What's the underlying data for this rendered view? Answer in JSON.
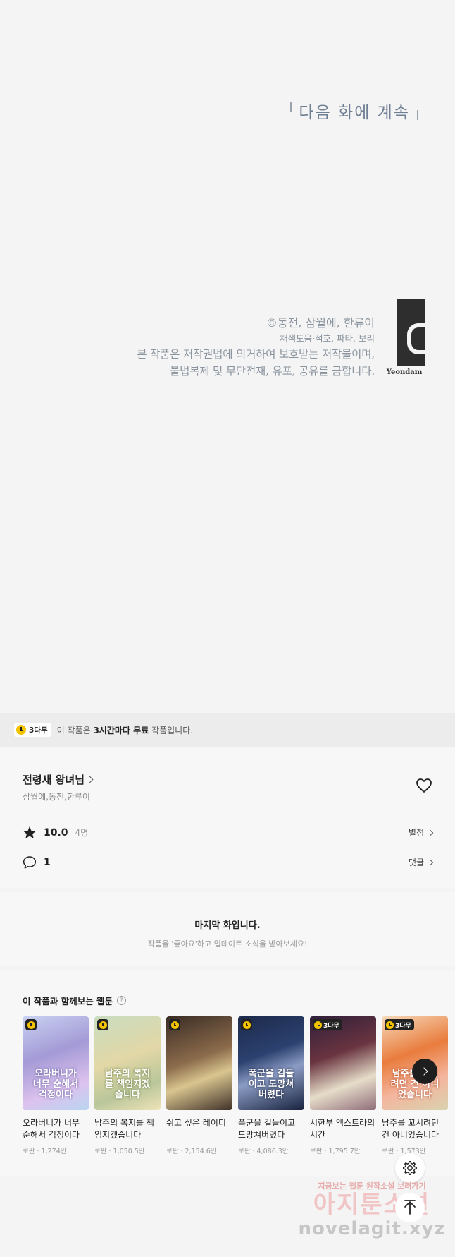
{
  "comic": {
    "next_episode": "다음 화에 계속",
    "credits": {
      "line1": "©동전, 삼월에, 한류이",
      "line2": "채색도움·석호, 파타, 보리",
      "line3": "본 작품은 저작권법에 의거하여 보호받는 저작물이며,",
      "line4": "불법복제 및 무단전재, 유포, 공유를 금합니다."
    },
    "publisher": "Yeondam"
  },
  "free_banner": {
    "badge": "3다무",
    "text_prefix": "이 작품은",
    "text_bold": "3시간마다 무료",
    "text_suffix": "작품입니다."
  },
  "work": {
    "title": "전령새 왕녀님",
    "authors": "삼월에,동전,한류이",
    "rating": "10.0",
    "rating_count": "4명",
    "rating_link": "별점",
    "comments": "1",
    "comments_link": "댓글"
  },
  "last_episode": {
    "heading": "마지막 화입니다.",
    "sub": "작품을 '좋아요'하고 업데이트 소식을 받아보세요!"
  },
  "recommendations": {
    "heading": "이 작품과 함께보는 웹툰",
    "items": [
      {
        "title": "오라버니가 너무 순해서 걱정이다",
        "meta": "로판 · 1,274만",
        "badge": "",
        "art": "오라버니가 너무 순해서 걱정이다"
      },
      {
        "title": "남주의 복지를 책임지겠습니다",
        "meta": "로판 · 1,050.5만",
        "badge": "",
        "art": "남주의 복지를 책임지겠습니다"
      },
      {
        "title": "쉬고 싶은 레이디",
        "meta": "로판 · 2,154.6만",
        "badge": "",
        "art": ""
      },
      {
        "title": "폭군을 길들이고 도망쳐버렸다",
        "meta": "로판 · 4,086.3만",
        "badge": "",
        "art": "폭군을 길들이고 도망쳐버렸다"
      },
      {
        "title": "시한부 엑스트라의 시간",
        "meta": "로판 · 1,795.7만",
        "badge": "3다무",
        "art": ""
      },
      {
        "title": "남주를 꼬시려던 건 아니었습니다",
        "meta": "로판 · 1,573만",
        "badge": "3다무",
        "art": "남주를 꼬시려던 건 아니었습니다"
      }
    ]
  },
  "watermark": {
    "line1": "지금보는 웹툰 원작소설 보러가기",
    "line2": "아지툰소설",
    "line3": "novelagit.xyz"
  },
  "colors": {
    "badge_yellow": "#f3c300",
    "next_episode_text": "#6f7f93",
    "background": "#f4f4f4"
  }
}
